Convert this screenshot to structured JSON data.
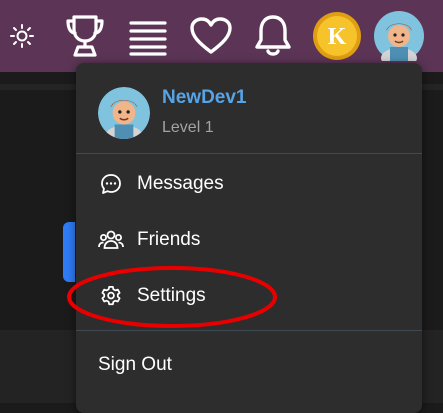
{
  "topbar": {
    "icons": [
      "sun-icon",
      "trophy-icon",
      "menu-icon",
      "heart-icon",
      "bell-icon",
      "coin-icon",
      "avatar"
    ],
    "coin_letter": "K"
  },
  "profile": {
    "username": "NewDev1",
    "level": "Level 1"
  },
  "menu": {
    "messages_label": "Messages",
    "friends_label": "Friends",
    "settings_label": "Settings",
    "signout_label": "Sign Out"
  },
  "colors": {
    "topbar_bg": "#5c3556",
    "dropdown_bg": "#2d2d2d",
    "username": "#56a4e6",
    "highlight": "#e80000"
  }
}
